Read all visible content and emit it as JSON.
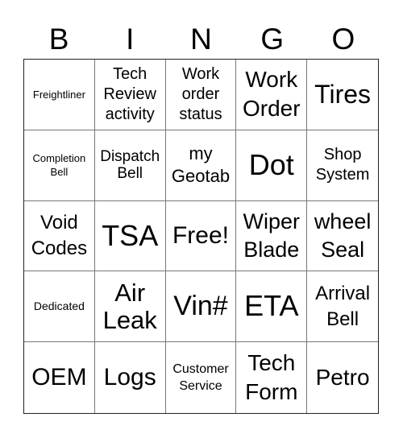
{
  "header": [
    "B",
    "I",
    "N",
    "G",
    "O"
  ],
  "cells": [
    [
      "Freightliner",
      "Tech Review activity",
      "Work order status",
      "Work Order",
      "Tires"
    ],
    [
      "Completion Bell",
      "Dispatch Bell",
      "my Geotab",
      "Dot",
      "Shop System"
    ],
    [
      "Void Codes",
      "TSA",
      "Free!",
      "Wiper Blade",
      "wheel Seal"
    ],
    [
      "Dedicated",
      "Air Leak",
      "Vin#",
      "ETA",
      "Arrival Bell"
    ],
    [
      "OEM",
      "Logs",
      "Customer Service",
      "Tech Form",
      "Petro"
    ]
  ]
}
